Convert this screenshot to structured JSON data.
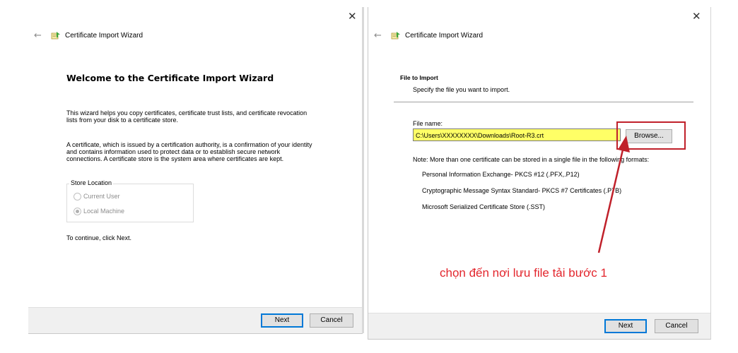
{
  "left_dialog": {
    "title": "Certificate Import Wizard",
    "heading": "Welcome to the Certificate Import Wizard",
    "para1_line1": "This wizard helps you copy certificates, certificate trust lists, and certificate revocation",
    "para1_line2": "lists from your disk to a certificate store.",
    "para2_line1": "A certificate, which is issued by a certification authority, is a confirmation of your identity",
    "para2_line2": "and contains information used to protect data or to establish secure network",
    "para2_line3": "connections. A certificate store is the system area where certificates are kept.",
    "store_location_label": "Store Location",
    "option_current_user": "Current User",
    "option_local_machine": "Local Machine",
    "selected_option": "Local Machine",
    "continue_text": "To continue, click Next.",
    "next_label": "Next",
    "cancel_label": "Cancel"
  },
  "right_dialog": {
    "title": "Certificate Import Wizard",
    "section_title": "File to Import",
    "section_subtitle": "Specify the file you want to import.",
    "file_name_label": "File name:",
    "file_name_value": "C:\\Users\\XXXXXXXX\\Downloads\\Root-R3.crt",
    "browse_label": "Browse...",
    "note_text": "Note:  More than one certificate can be stored in a single file in the following formats:",
    "formats": [
      "Personal Information Exchange- PKCS #12 (.PFX,.P12)",
      "Cryptographic Message Syntax Standard- PKCS #7 Certificates (.P7B)",
      "Microsoft Serialized Certificate Store (.SST)"
    ],
    "next_label": "Next",
    "cancel_label": "Cancel"
  },
  "annotation": {
    "text": "chọn đến nơi lưu file tải bước 1",
    "color": "#e3262d"
  },
  "icons": {
    "close": "close-icon",
    "back": "back-arrow-icon",
    "certificate": "certificate-icon"
  }
}
